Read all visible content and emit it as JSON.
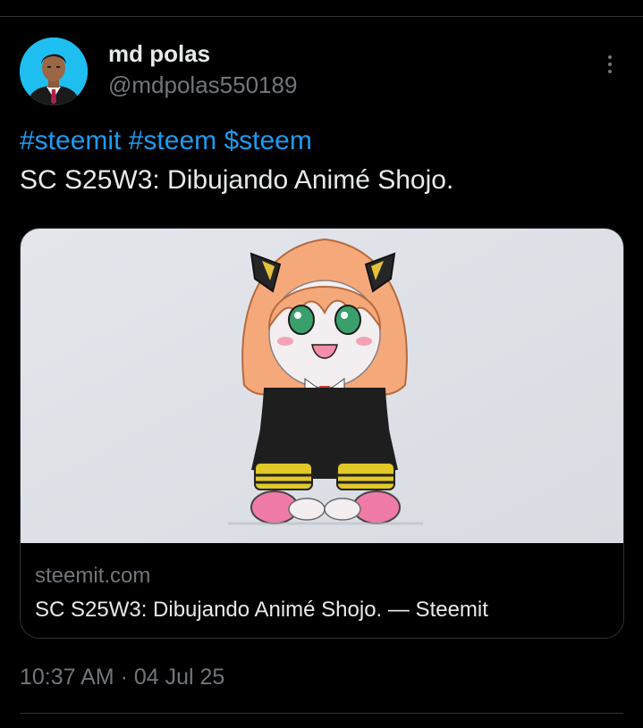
{
  "author": {
    "name": "md polas",
    "handle": "@mdpolas550189"
  },
  "tweet": {
    "hashtags": [
      "#steemit",
      "#steem",
      "$steem"
    ],
    "text": "SC S25W3: Dibujando Animé Shojo."
  },
  "link_card": {
    "domain": "steemit.com",
    "title": "SC S25W3: Dibujando Animé Shojo. — Steemit"
  },
  "meta": {
    "time": "10:37 AM",
    "separator": "·",
    "date": "04 Jul 25"
  },
  "icons": {
    "more": "more-vertical-icon"
  },
  "colors": {
    "background": "#000000",
    "text_primary": "#e7e9ea",
    "text_secondary": "#71767b",
    "link": "#1d9bf0",
    "divider": "#2f3336",
    "avatar_bg": "#1ebff0"
  }
}
